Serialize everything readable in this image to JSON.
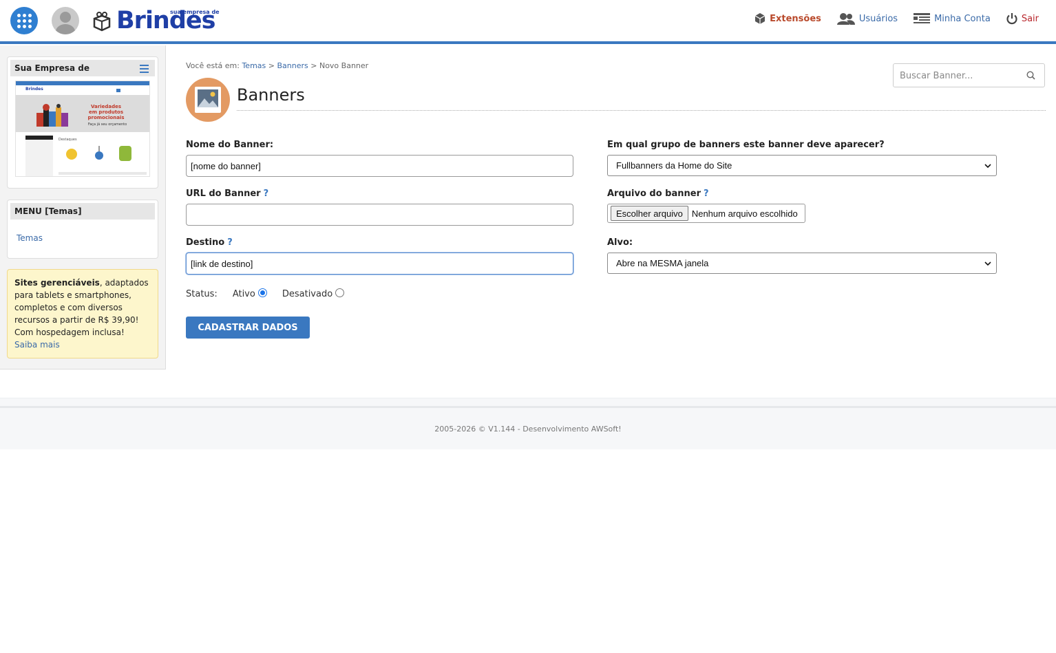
{
  "header": {
    "logo_text": "Brindes",
    "logo_tagline": "sua empresa de",
    "nav": {
      "extensions": "Extensões",
      "users": "Usuários",
      "account": "Minha Conta",
      "logout": "Sair"
    }
  },
  "sidebar": {
    "site_card_title": "Sua Empresa de",
    "menu_card_title": "MENU [Temas]",
    "menu_items": [
      "Temas"
    ],
    "preview": {
      "brand": "Brindes",
      "banner_line1": "Variedades",
      "banner_line2": "em produtos",
      "banner_line3": "promocionais",
      "banner_sub": "Faça já seu orçamento",
      "section": "Destaques"
    },
    "promo": {
      "bold": "Sites gerenciáveis",
      "text": ", adaptados para tablets e smartphones, completos e com diversos recursos a partir de R$ 39,90! Com hospedagem inclusa!",
      "link": "Saiba mais"
    }
  },
  "breadcrumb": {
    "prefix": "Você está em:",
    "items": [
      "Temas",
      "Banners"
    ],
    "current": "Novo Banner",
    "separator": ">"
  },
  "search": {
    "placeholder": "Buscar Banner..."
  },
  "page": {
    "title": "Banners"
  },
  "form": {
    "name_label": "Nome do Banner:",
    "name_value": "[nome do banner]",
    "url_label": "URL do Banner",
    "url_value": "",
    "dest_label": "Destino",
    "dest_value": "[link de destino]",
    "help_mark": "?",
    "group_label": "Em qual grupo de banners este banner deve aparecer?",
    "group_value": "Fullbanners da Home do Site",
    "file_label": "Arquivo do banner",
    "file_button": "Escolher arquivo",
    "file_status": "Nenhum arquivo escolhido",
    "target_label": "Alvo:",
    "target_value": "Abre na MESMA janela",
    "status_label": "Status:",
    "status_active": "Ativo",
    "status_inactive": "Desativado",
    "submit": "CADASTRAR DADOS"
  },
  "footer": {
    "text": "2005-2026 © V1.144 - Desenvolvimento AWSoft!"
  },
  "colors": {
    "accent": "#3a78c0",
    "brand": "#1f3fa6",
    "title_icon_bg": "#e39a63",
    "promo_bg": "#fdf6cc"
  }
}
